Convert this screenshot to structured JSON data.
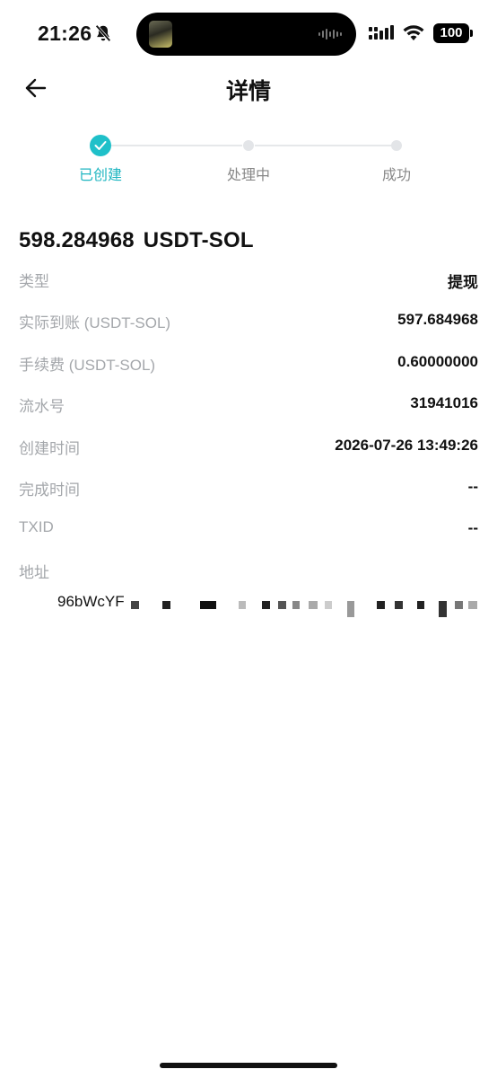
{
  "status_bar": {
    "time": "21:26",
    "battery": "100"
  },
  "header": {
    "title": "详情"
  },
  "stepper": {
    "steps": [
      {
        "label": "已创建",
        "state": "done"
      },
      {
        "label": "处理中",
        "state": "pending"
      },
      {
        "label": "成功",
        "state": "pending"
      }
    ],
    "accent_color": "#1fc0c9"
  },
  "summary": {
    "amount": "598.284968",
    "currency": "USDT-SOL"
  },
  "details": [
    {
      "label": "类型",
      "value": "提现"
    },
    {
      "label": "实际到账 (USDT-SOL)",
      "value": "597.684968"
    },
    {
      "label": "手续费 (USDT-SOL)",
      "value": "0.60000000"
    },
    {
      "label": "流水号",
      "value": "31941016"
    },
    {
      "label": "创建时间",
      "value": "2026-07-26 13:49:26"
    },
    {
      "label": "完成时间",
      "value": "--"
    },
    {
      "label": "TXID",
      "value": "--"
    }
  ],
  "address": {
    "label": "地址",
    "value_visible": "96bWcYF"
  }
}
